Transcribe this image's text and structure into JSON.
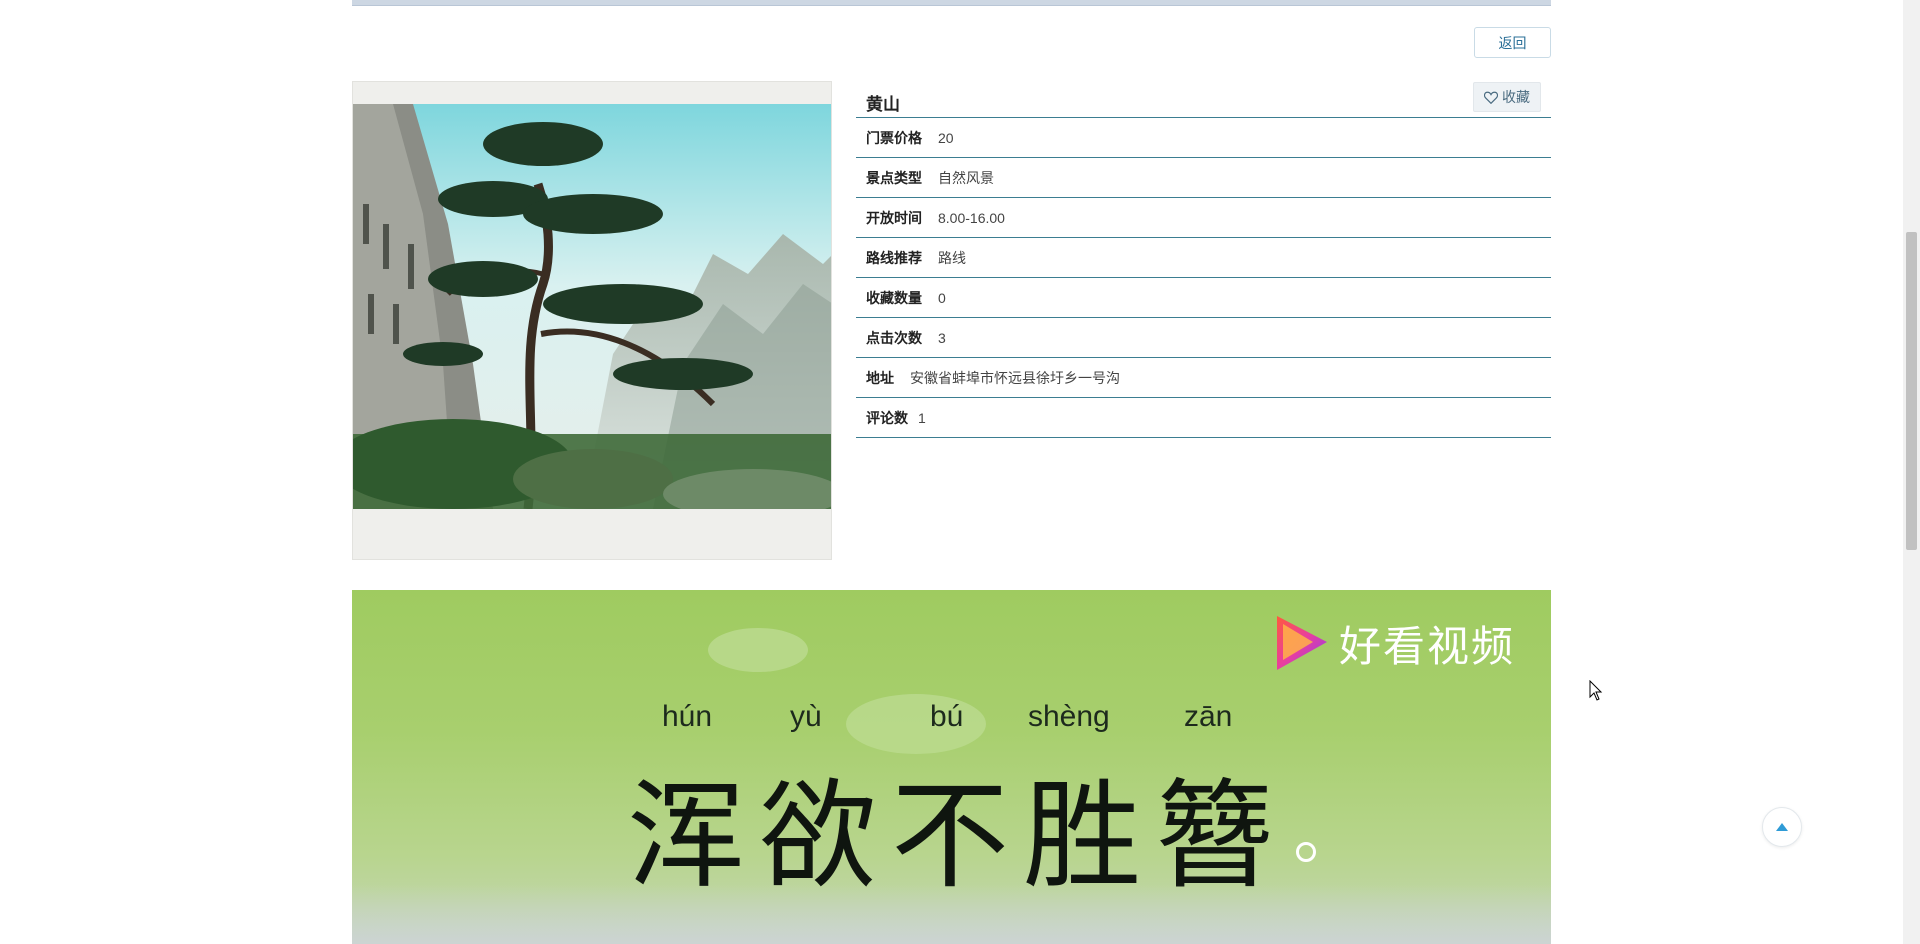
{
  "page": {
    "back_label": "返回"
  },
  "spot": {
    "name": "黄山",
    "favorite_label": "收藏",
    "fields": [
      {
        "label": "门票价格",
        "value": "20"
      },
      {
        "label": "景点类型",
        "value": "自然风景"
      },
      {
        "label": "开放时间",
        "value": "8.00-16.00"
      },
      {
        "label": "路线推荐",
        "value": "路线"
      },
      {
        "label": "收藏数量",
        "value": "0"
      },
      {
        "label": "点击次数",
        "value": "3"
      },
      {
        "label": "地址",
        "value": "安徽省蚌埠市怀远县徐圩乡一号沟"
      },
      {
        "label": "评论数",
        "value": "1"
      }
    ]
  },
  "video": {
    "brand": "好看视频",
    "pinyin": [
      "hún",
      "yù",
      "bú",
      "shèng",
      "zān"
    ],
    "caption": "浑欲不胜簪"
  },
  "icons": {
    "favorite": "heart-outline-icon",
    "to_top": "caret-up-icon",
    "brand_logo": "play-triangle-logo"
  },
  "colors": {
    "accent_line": "#3b7d91",
    "link": "#2a6f97",
    "video_green": "#9fcb60"
  }
}
